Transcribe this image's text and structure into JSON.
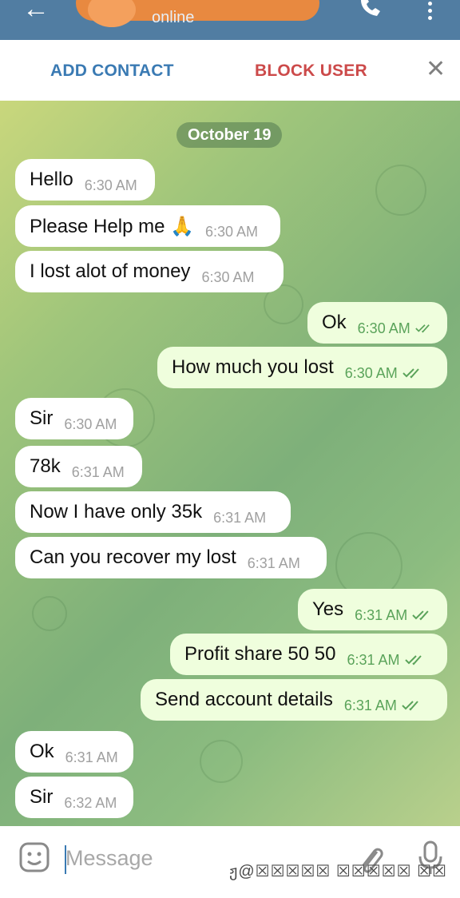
{
  "header": {
    "status": "online",
    "back_icon": "arrow-left-icon",
    "call_icon": "phone-icon",
    "menu_icon": "more-vertical-icon"
  },
  "actions": {
    "add_contact": "ADD CONTACT",
    "block_user": "BLOCK USER",
    "close_icon": "close-icon"
  },
  "chat": {
    "date": "October 19",
    "messages": [
      {
        "dir": "in",
        "text": "Hello",
        "time": "6:30 AM"
      },
      {
        "dir": "in",
        "text": "Please Help me 🙏",
        "time": "6:30 AM"
      },
      {
        "dir": "in",
        "text": "I lost alot of money",
        "time": "6:30 AM"
      },
      {
        "dir": "out",
        "text": "Ok",
        "time": "6:30 AM"
      },
      {
        "dir": "out",
        "text": "How much you lost",
        "time": "6:30 AM"
      },
      {
        "dir": "in",
        "text": "Sir",
        "time": "6:30 AM"
      },
      {
        "dir": "in",
        "text": "78k",
        "time": "6:31 AM"
      },
      {
        "dir": "in",
        "text": "Now I have only 35k",
        "time": "6:31 AM"
      },
      {
        "dir": "in",
        "text": "Can you recover my lost",
        "time": "6:31 AM"
      },
      {
        "dir": "out",
        "text": "Yes",
        "time": "6:31 AM"
      },
      {
        "dir": "out",
        "text": "Profit share 50 50",
        "time": "6:31 AM"
      },
      {
        "dir": "out",
        "text": "Send account details",
        "time": "6:31 AM"
      },
      {
        "dir": "in",
        "text": "Ok",
        "time": "6:31 AM"
      },
      {
        "dir": "in",
        "text": "Sir",
        "time": "6:32 AM"
      }
    ]
  },
  "input": {
    "placeholder": "Message",
    "emoji_icon": "emoji-icon",
    "attach_icon": "paperclip-icon",
    "mic_icon": "microphone-icon"
  },
  "watermark": "ჟ@☒☒☒☒☒ ☒☒☒☒☒ ☒☒",
  "colors": {
    "header": "#517da2",
    "outgoing": "#effedd",
    "incoming": "#ffffff",
    "link": "#3a7ab3",
    "danger": "#cc4a4a"
  }
}
